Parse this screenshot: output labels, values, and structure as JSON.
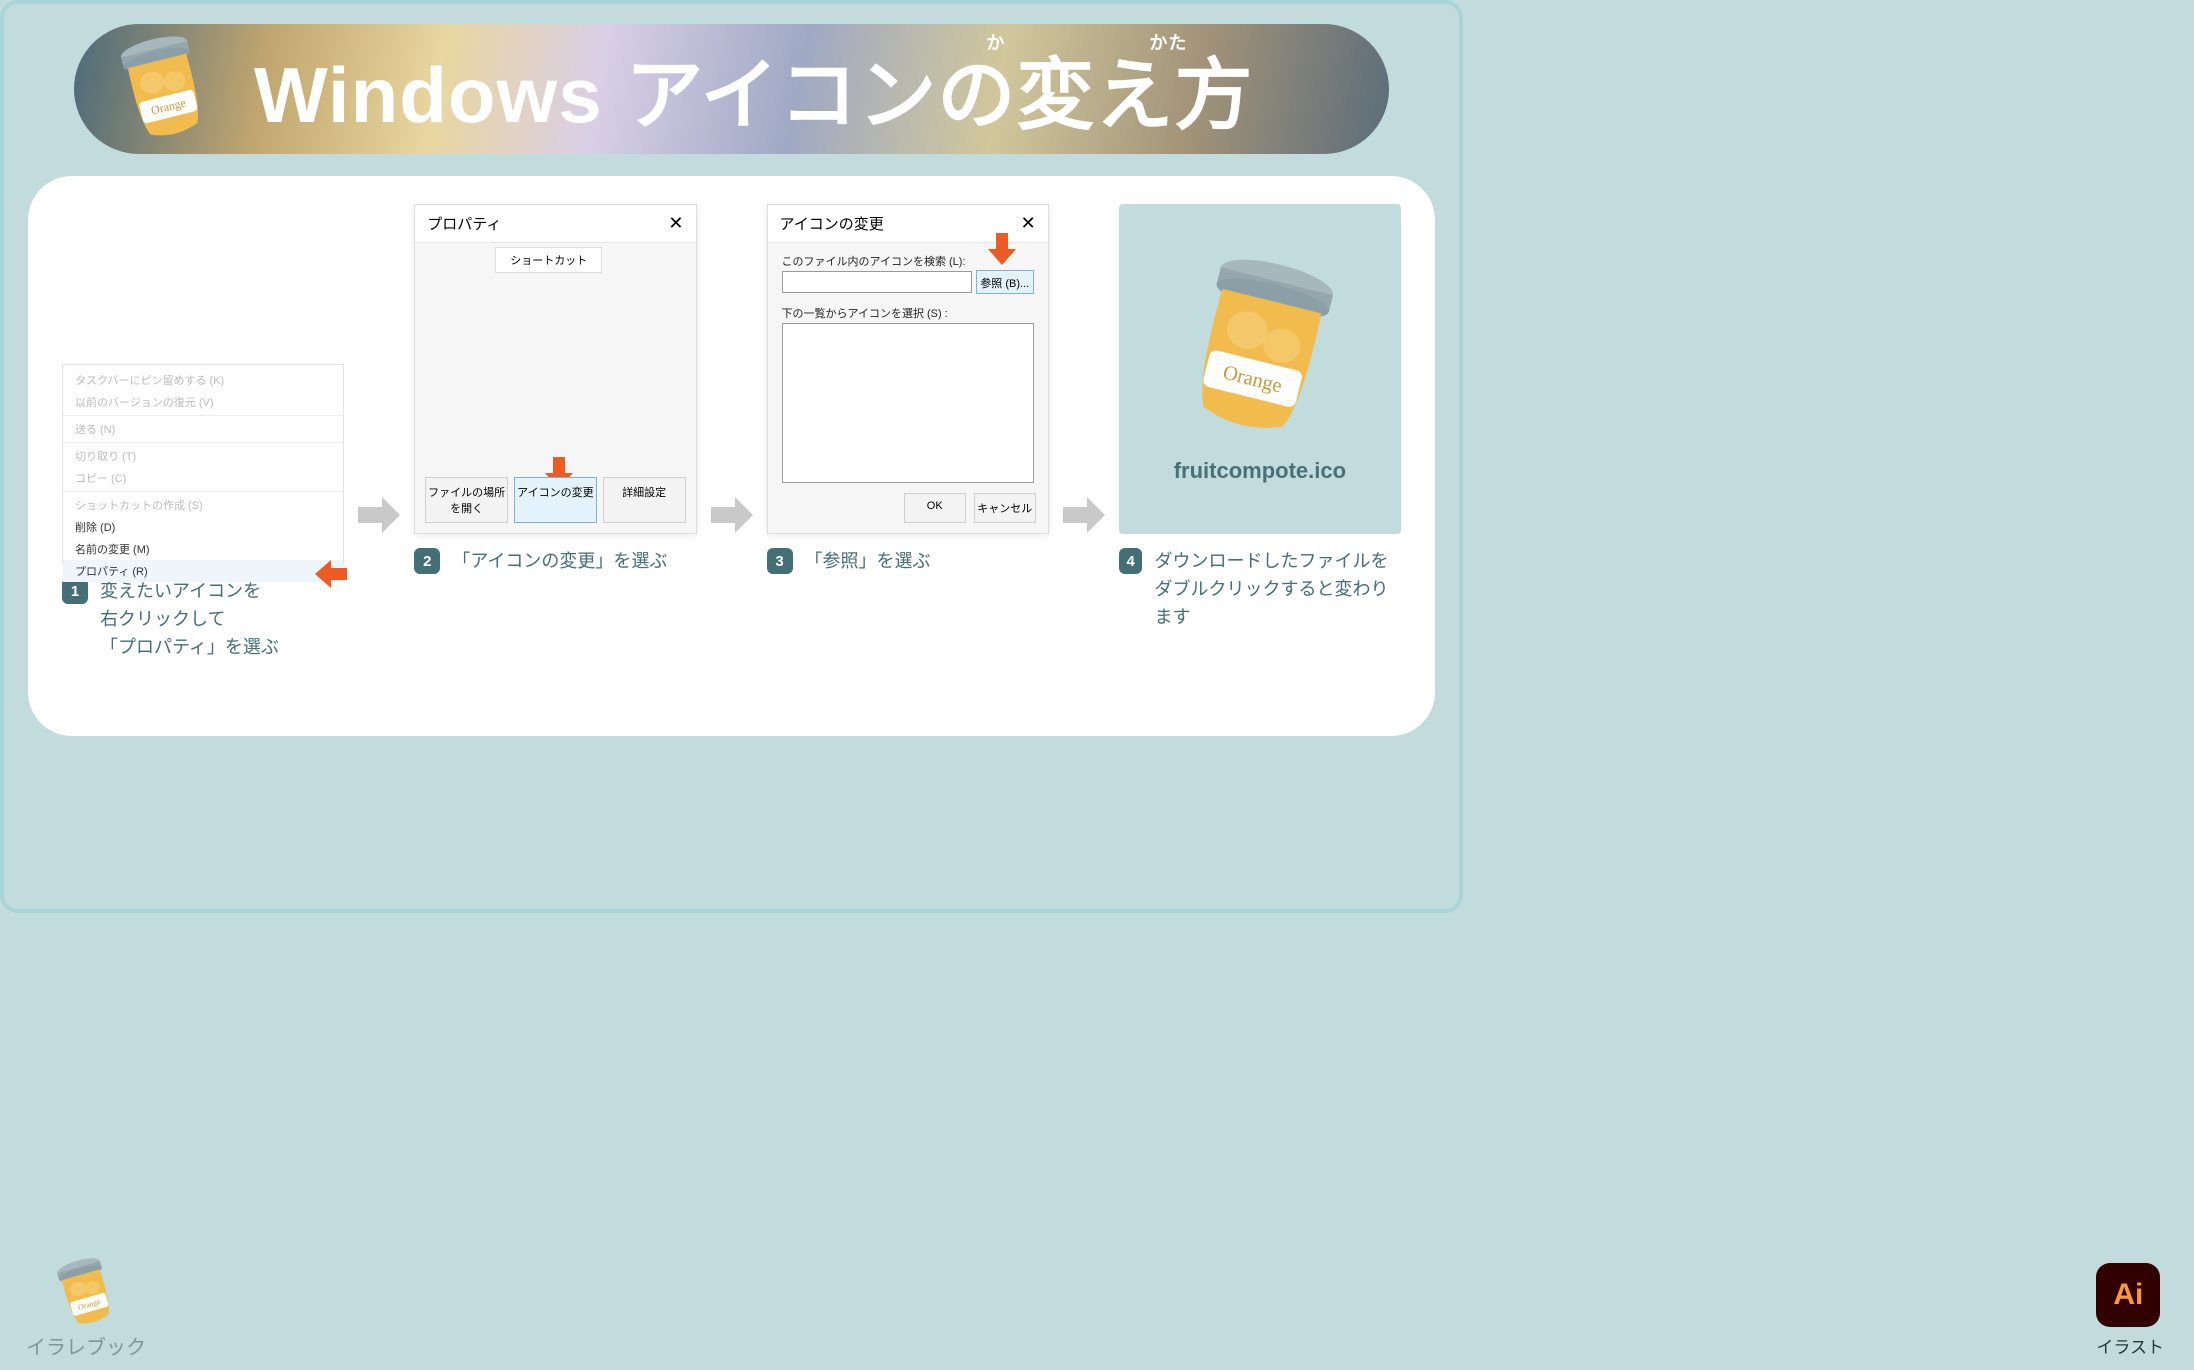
{
  "banner": {
    "title": "Windows アイコンの変え方",
    "ruby1": "か",
    "ruby2": "かた"
  },
  "steps": [
    {
      "num": "1",
      "caption_l1": "変えたいアイコンを",
      "caption_l2": "右クリックして",
      "caption_l3": "「プロパティ」を選ぶ",
      "ctx": {
        "i1": "タスクバーにピン留めする (K)",
        "i2": "以前のバージョンの復元 (V)",
        "i3": "送る (N)",
        "i4": "切り取り (T)",
        "i5": "コピー (C)",
        "i6": "ショットカットの作成 (S)",
        "i7": "削除 (D)",
        "i8": "名前の変更 (M)",
        "i9": "プロパティ (R)"
      }
    },
    {
      "num": "2",
      "caption_l1": "「アイコンの変更」を選ぶ",
      "dlg": {
        "title": "プロパティ",
        "tab": "ショートカット",
        "b1": "ファイルの場所を開く",
        "b2": "アイコンの変更",
        "b3": "詳細設定"
      }
    },
    {
      "num": "3",
      "caption_l1": "「参照」を選ぶ",
      "dlg": {
        "title": "アイコンの変更",
        "l1": "このファイル内のアイコンを検索 (L):",
        "browse": "参照 (B)...",
        "l2": "下の一覧からアイコンを選択 (S) :",
        "ok": "OK",
        "cancel": "キャンセル"
      }
    },
    {
      "num": "4",
      "caption_l1": "ダウンロードしたファイルを",
      "caption_l2": "ダブルクリックすると変わります",
      "filename": "fruitcompote.ico"
    }
  ],
  "footer": {
    "brand": "イラレブック",
    "ai": "Ai",
    "ai_lbl": "イラスト"
  }
}
